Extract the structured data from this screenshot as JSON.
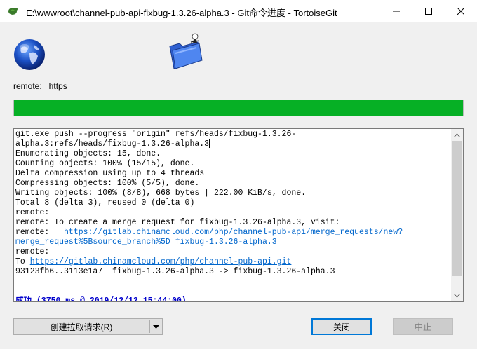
{
  "window": {
    "title": "E:\\wwwroot\\channel-pub-api-fixbug-1.3.26-alpha.3 - Git命令进度 - TortoiseGit",
    "icons": {
      "app": "tortoisegit-app-icon",
      "minimize": "minimize-icon",
      "maximize": "maximize-icon",
      "close": "close-icon"
    }
  },
  "header": {
    "globe_icon": "globe-icon",
    "folder_icon": "folder-with-tortoise-icon"
  },
  "remote": {
    "label": "remote:   https"
  },
  "progress": {
    "fraction": 1.0,
    "color": "#06b025"
  },
  "log": {
    "lines": [
      [
        {
          "t": "git.exe push --progress \"origin\" refs/heads/fixbug-1.3.26-"
        }
      ],
      [
        {
          "t": "alpha.3:refs/heads/fixbug-1.3.26-alpha.3"
        },
        {
          "caret": true
        }
      ],
      [
        {
          "t": "Enumerating objects: 15, done."
        }
      ],
      [
        {
          "t": "Counting objects: 100% (15/15), done."
        }
      ],
      [
        {
          "t": "Delta compression using up to 4 threads"
        }
      ],
      [
        {
          "t": "Compressing objects: 100% (5/5), done."
        }
      ],
      [
        {
          "t": "Writing objects: 100% (8/8), 668 bytes | 222.00 KiB/s, done."
        }
      ],
      [
        {
          "t": "Total 8 (delta 3), reused 0 (delta 0)"
        }
      ],
      [
        {
          "t": "remote:"
        }
      ],
      [
        {
          "t": "remote: To create a merge request for fixbug-1.3.26-alpha.3, visit:"
        }
      ],
      [
        {
          "t": "remote:   "
        },
        {
          "t": "https://gitlab.chinamcloud.com/php/channel-pub-api/merge_requests/new?",
          "link": true
        }
      ],
      [
        {
          "t": "merge_request%5Bsource_branch%5D=fixbug-1.3.26-alpha.3",
          "link": true
        }
      ],
      [
        {
          "t": "remote:"
        }
      ],
      [
        {
          "t": "To "
        },
        {
          "t": "https://gitlab.chinamcloud.com/php/channel-pub-api.git",
          "link": true
        }
      ],
      [
        {
          "t": "93123fb6..3113e1a7  fixbug-1.3.26-alpha.3 -> fixbug-1.3.26-alpha.3"
        }
      ],
      [
        {
          "t": ""
        }
      ],
      [
        {
          "t": ""
        }
      ],
      [
        {
          "t": "成功 (3750 ms @ 2019/12/12 15:44:00)",
          "success": true
        }
      ]
    ],
    "link_color": "#0066cc",
    "success_color": "#0000cc"
  },
  "buttons": {
    "create_pr": "创建拉取请求(R)",
    "close": "关闭",
    "abort": "中止"
  }
}
